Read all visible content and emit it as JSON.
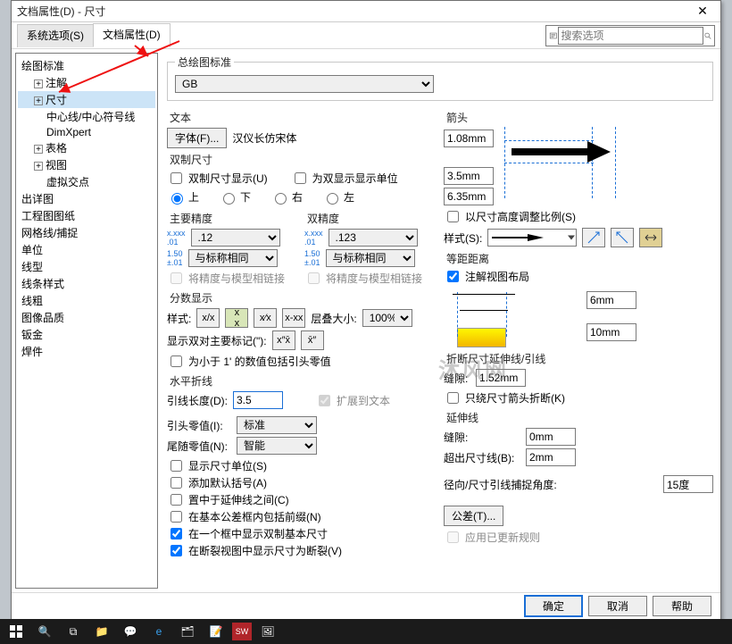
{
  "window": {
    "title": "文档属性(D) - 尺寸"
  },
  "tabs": {
    "system": "系统选项(S)",
    "doc": "文档属性(D)"
  },
  "search": {
    "placeholder": "搜索选项"
  },
  "tree": {
    "root": "绘图标准",
    "annot": "注解",
    "dim": "尺寸",
    "centerline": "中心线/中心符号线",
    "dimxpert": "DimXpert",
    "table": "表格",
    "view": "视图",
    "virtual": "虚拟交点",
    "detail": "出详图",
    "drawing_sheet": "工程图图纸",
    "grid": "网格线/捕捉",
    "units": "单位",
    "linetype": "线型",
    "linestyle": "线条样式",
    "linew": "线粗",
    "imgq": "图像品质",
    "sheetmetal": "钣金",
    "weld": "焊件"
  },
  "overall": {
    "label": "总绘图标准",
    "value": "GB"
  },
  "text": {
    "label": "文本",
    "font_btn": "字体(F)...",
    "font_name": "汉仪长仿宋体"
  },
  "dual": {
    "label": "双制尺寸",
    "show": "双制尺寸显示(U)",
    "dualunits": "为双显示显示单位",
    "pos_top": "上",
    "pos_bottom": "下",
    "pos_right": "右",
    "pos_left": "左"
  },
  "precision": {
    "primary_label": "主要精度",
    "dual_label": "双精度",
    "primary": ".12",
    "dual": ".123",
    "tol_same_primary": "与标称相同",
    "tol_same_dual": "与标称相同",
    "link_primary": "将精度与模型相链接",
    "link_dual": "将精度与模型相链接"
  },
  "fraction": {
    "label": "分数显示",
    "style_label": "样式:",
    "stack_label": "层叠大小:",
    "stack_value": "100%",
    "show_dual_label": "显示双对主要标记(\"):",
    "below1": "为小于 1' 的数值包括引头零值"
  },
  "hbreak": {
    "label": "水平折线",
    "leader_len_label": "引线长度(D):",
    "leader_len": "3.5",
    "extend": "扩展到文本"
  },
  "zeros": {
    "leading_label": "引头零值(I):",
    "leading": "标准",
    "trailing_label": "尾随零值(N):",
    "trailing": "智能"
  },
  "opts": {
    "show_units": "显示尺寸单位(S)",
    "add_paren": "添加默认括号(A)",
    "center_ext": "置中于延伸线之间(C)",
    "prefix_tol": "在基本公差框内包括前缀(N)",
    "dual_box": "在一个框中显示双制基本尺寸",
    "break_view": "在断裂视图中显示尺寸为断裂(V)"
  },
  "arrows": {
    "label": "箭头",
    "v1": "1.08mm",
    "v2": "3.5mm",
    "v3": "6.35mm",
    "scale_height": "以尺寸高度调整比例(S)",
    "style_label": "样式(S):"
  },
  "eq": {
    "label": "等距距离",
    "anno_layout": "注解视图布局",
    "d1": "6mm",
    "d2": "10mm"
  },
  "breakext": {
    "label": "折断尺寸延伸线/引线",
    "gap_label": "缝隙:",
    "gap": "1.52mm",
    "arrows_only": "只绕尺寸箭头折断(K)"
  },
  "extline": {
    "label": "延伸线",
    "gap_label": "缝隙:",
    "gap": "0mm",
    "overshoot_label": "超出尺寸线(B):",
    "overshoot": "2mm"
  },
  "radial": {
    "label": "径向/尺寸引线捕捉角度:",
    "value": "15度"
  },
  "tol_btn": "公差(T)...",
  "apply_rules": "应用已更新规则",
  "footer": {
    "ok": "确定",
    "cancel": "取消",
    "help": "帮助"
  },
  "watermark": "沐风网"
}
